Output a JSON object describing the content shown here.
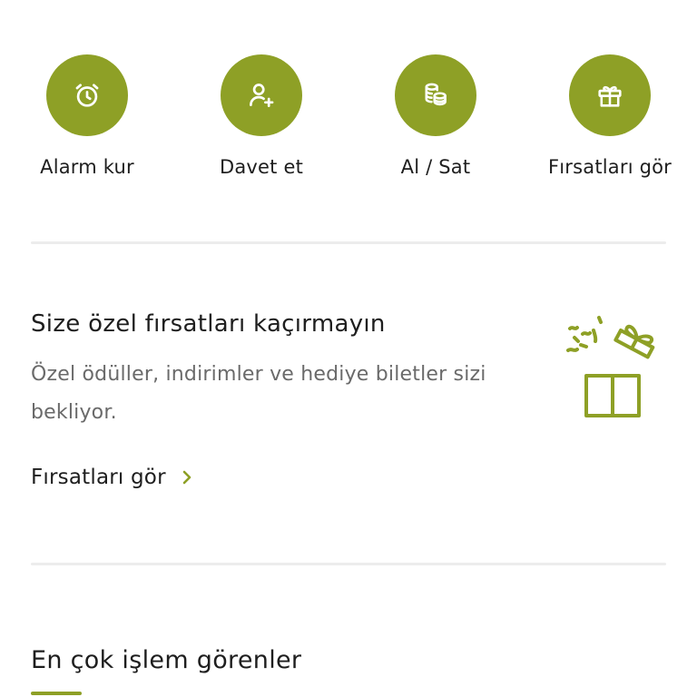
{
  "colors": {
    "accent": "#8ea026",
    "text": "#1e1e1e",
    "muted": "#6a6a6a",
    "divider": "#ececec"
  },
  "quick_actions": [
    {
      "icon": "alarm-clock-icon",
      "label": "Alarm kur"
    },
    {
      "icon": "add-user-icon",
      "label": "Davet et"
    },
    {
      "icon": "coins-icon",
      "label": "Al / Sat"
    },
    {
      "icon": "gift-icon",
      "label": "Fırsatları gör"
    }
  ],
  "promo": {
    "title": "Size özel fırsatları kaçırmayın",
    "description": "Özel ödüller, indirimler ve hediye biletler sizi bekliyor.",
    "link_label": "Fırsatları gör",
    "illustration": "open-gift-box-icon"
  },
  "section": {
    "title": "En çok işlem görenler"
  }
}
